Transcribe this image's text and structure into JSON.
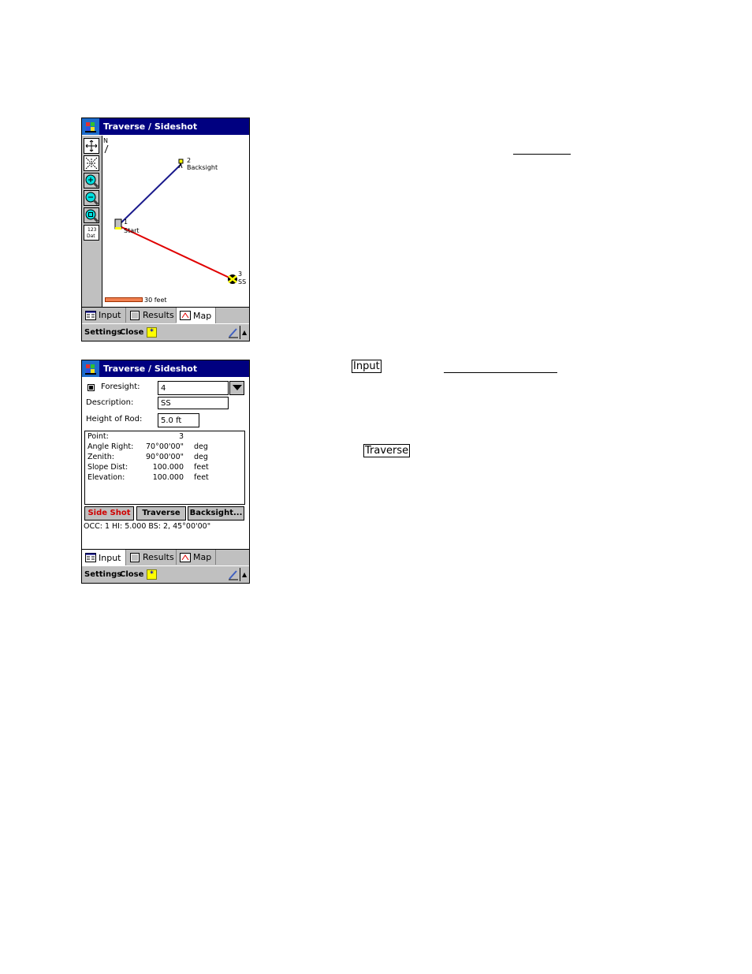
{
  "screens": [
    {
      "name": "map",
      "title": "Traverse / Sideshot",
      "north_label": "N",
      "tools": [
        "zoom-extents",
        "zoom-all",
        "zoom-in",
        "zoom-out",
        "zoom-window",
        "point-labels"
      ],
      "points": [
        {
          "id": "1",
          "label": "Start"
        },
        {
          "id": "2",
          "label": "Backsight"
        },
        {
          "id": "3",
          "label": "SS"
        }
      ],
      "scale_label": "30 feet",
      "colors": {
        "backsight_line": "#1a1a8c",
        "sideshot_line": "#e00000",
        "scale_bar": "#f08050"
      }
    },
    {
      "name": "input",
      "title": "Traverse / Sideshot",
      "foresight_label": "Foresight:",
      "foresight_value": "4",
      "description_label": "Description:",
      "description_value": "SS",
      "rod_label": "Height of Rod:",
      "rod_value": "5.0 ft",
      "results": [
        {
          "label": "Point:",
          "value": "3",
          "unit": ""
        },
        {
          "label": "Angle Right:",
          "value": "70°00'00\"",
          "unit": "deg"
        },
        {
          "label": "Zenith:",
          "value": "90°00'00\"",
          "unit": "deg"
        },
        {
          "label": "Slope Dist:",
          "value": "100.000",
          "unit": "feet"
        },
        {
          "label": "Elevation:",
          "value": "100.000",
          "unit": "feet"
        }
      ],
      "buttons": {
        "side_shot": "Side Shot",
        "traverse": "Traverse",
        "backsight": "Backsight..."
      },
      "status": "OCC: 1  HI: 5.000  BS: 2, 45°00'00\""
    }
  ],
  "tabs": {
    "input": "Input",
    "results": "Results",
    "map": "Map"
  },
  "commandbar": {
    "settings": "Settings",
    "close": "Close",
    "sip": "*",
    "up": "▲"
  },
  "annotations": {
    "input_box": "Input",
    "traverse_box": "Traverse"
  }
}
